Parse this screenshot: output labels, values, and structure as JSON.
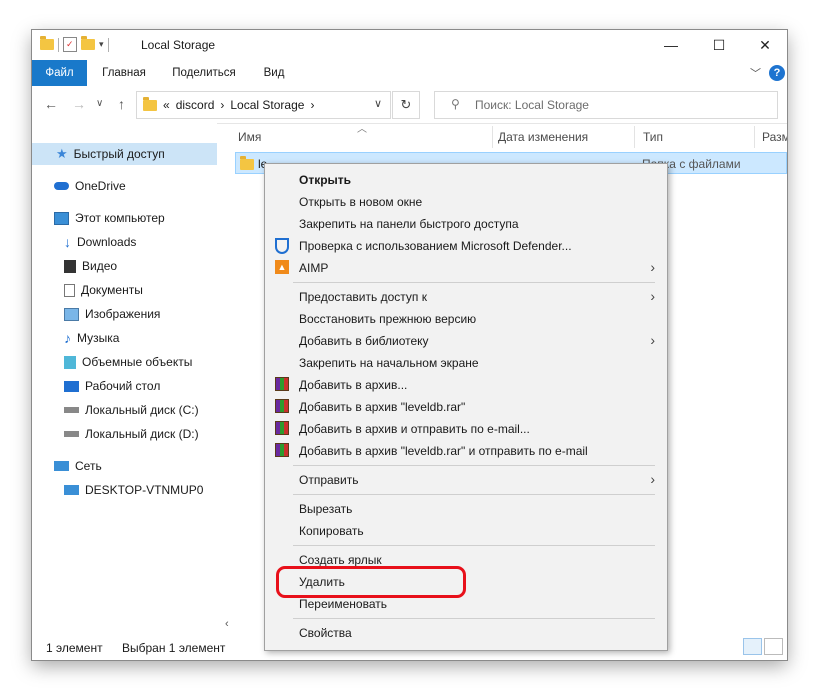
{
  "window": {
    "title": "Local Storage",
    "controls": {
      "minimize": "—",
      "maximize": "☐",
      "close": "✕"
    }
  },
  "ribbon": {
    "tabs": [
      "Файл",
      "Главная",
      "Поделиться",
      "Вид"
    ],
    "help": "?"
  },
  "navbar": {
    "breadcrumb": [
      "«",
      "discord",
      "Local Storage"
    ],
    "search_placeholder": "Поиск: Local Storage"
  },
  "nav_pane": {
    "quick_access": "Быстрый доступ",
    "onedrive": "OneDrive",
    "this_pc": "Этот компьютер",
    "items": [
      "Downloads",
      "Видео",
      "Документы",
      "Изображения",
      "Музыка",
      "Объемные объекты",
      "Рабочий стол",
      "Локальный диск (C:)",
      "Локальный диск (D:)"
    ],
    "network": "Сеть",
    "desktop": "DESKTOP-VTNMUP0"
  },
  "columns": {
    "name": "Имя",
    "date": "Дата изменения",
    "type": "Тип",
    "size": "Разм"
  },
  "file_row": {
    "name": "le",
    "type": "Папка с файлами"
  },
  "status": {
    "count": "1 элемент",
    "selected": "Выбран 1 элемент"
  },
  "context_menu": {
    "open": "Открыть",
    "open_new_window": "Открыть в новом окне",
    "pin_quick": "Закрепить на панели быстрого доступа",
    "defender": "Проверка с использованием Microsoft Defender...",
    "aimp": "AIMP",
    "give_access": "Предоставить доступ к",
    "restore": "Восстановить прежнюю версию",
    "add_library": "Добавить в библиотеку",
    "pin_start": "Закрепить на начальном экране",
    "add_archive": "Добавить в архив...",
    "add_archive_named": "Добавить в архив \"leveldb.rar\"",
    "add_archive_email": "Добавить в архив и отправить по e-mail...",
    "add_archive_named_email": "Добавить в архив \"leveldb.rar\" и отправить по e-mail",
    "send_to": "Отправить",
    "cut": "Вырезать",
    "copy": "Копировать",
    "create_shortcut": "Создать ярлык",
    "delete": "Удалить",
    "rename": "Переименовать",
    "properties": "Свойства"
  },
  "colors": {
    "accent": "#1979ca",
    "selection": "#cce8ff",
    "highlight_ring": "#e8101a"
  }
}
